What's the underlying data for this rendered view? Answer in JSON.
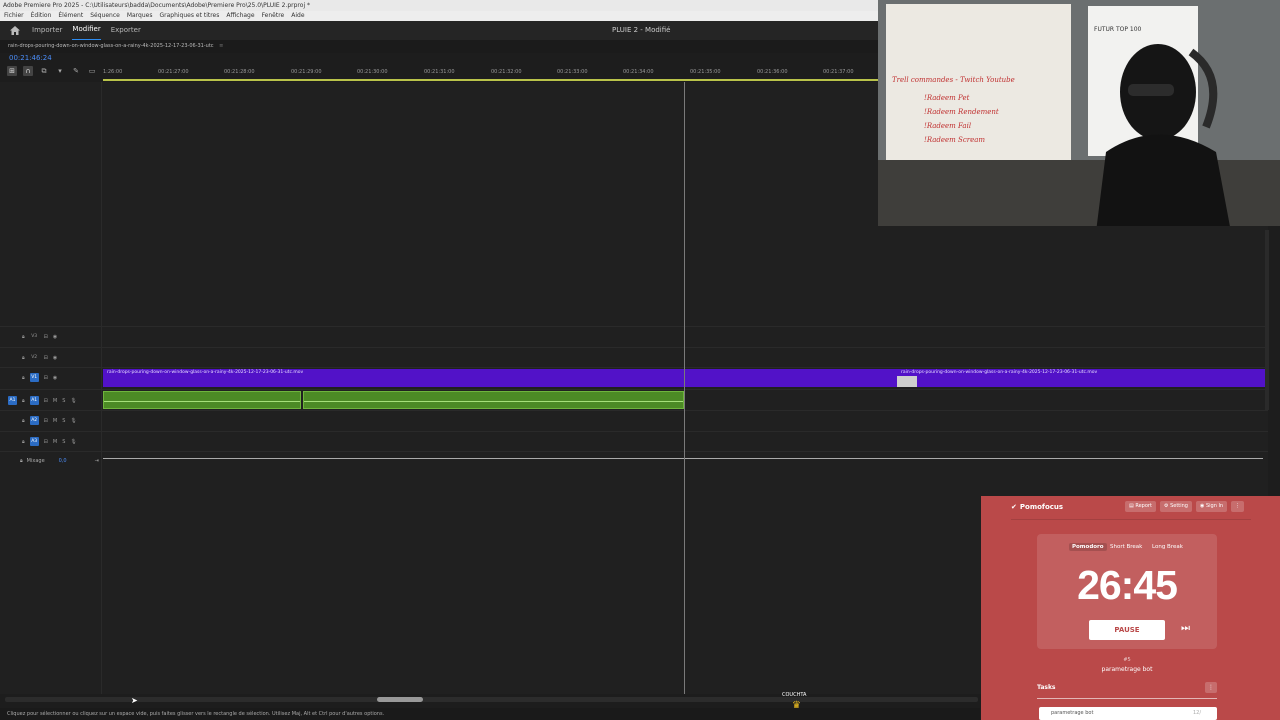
{
  "window": {
    "title": "Adobe Premiere Pro 2025 - C:\\Utilisateurs\\badda\\Documents\\Adobe\\Premiere Pro\\25.0\\PLUIE 2.prproj *"
  },
  "menu": [
    "Fichier",
    "Édition",
    "Élément",
    "Séquence",
    "Marques",
    "Graphiques et titres",
    "Affichage",
    "Fenêtre",
    "Aide"
  ],
  "appbar": {
    "tabs": [
      "Importer",
      "Modifier",
      "Exporter"
    ],
    "active_tab": "Modifier",
    "project": "PLUIE 2 - Modifié"
  },
  "sequence": {
    "tab_label": "rain-drops-pouring-down-on-window-glass-on-a-rainy-4k-2025-12-17-23-06-31-utc",
    "menu_glyph": "≡",
    "timecode": "00:21:46:24"
  },
  "ruler": [
    "1:26:00",
    "00:21:27:00",
    "00:21:28:00",
    "00:21:29:00",
    "00:21:30:00",
    "00:21:31:00",
    "00:21:32:00",
    "00:21:33:00",
    "00:21:34:00",
    "00:21:35:00",
    "00:21:36:00",
    "00:21:37:00"
  ],
  "tracks": {
    "video": [
      {
        "id": "V3"
      },
      {
        "id": "V2"
      },
      {
        "id": "V1"
      }
    ],
    "audio": [
      {
        "id": "A1",
        "m": "M",
        "s": "S"
      },
      {
        "id": "A2",
        "m": "M",
        "s": "S"
      },
      {
        "id": "A3",
        "m": "M",
        "s": "S"
      }
    ],
    "source_v1": "V1",
    "source_a1": "A1",
    "mix_label": "Mixage",
    "mix_value": "0,0"
  },
  "clips": {
    "video_label": "rain-drops-pouring-down-on-window-glass-on-a-rainy-4k-2025-12-17-23-06-31-utc.mov",
    "video2_label": "rain-drops-pouring-down-on-window-glass-on-a-rainy-4k-2025-12-17-23-06-31-utc.mov"
  },
  "status": "Cliquez pour sélectionner ou cliquez sur un espace vide, puis faites glisser vers le rectangle de sélection. Utilisez Maj, Alt et Ctrl pour d'autres options.",
  "overlay": {
    "couchta": "COUCHTA"
  },
  "webcam": {
    "board_lines": [
      "Trell commandes - Twitch Youtube",
      "!Radeem Pet",
      "!Radeem Rendement",
      "!Radeem Fail",
      "!Radeem Scream"
    ],
    "sign": "FUTUR TOP 100"
  },
  "pomofocus": {
    "brand": "Pomofocus",
    "buttons": [
      "Report",
      "Setting",
      "Sign In"
    ],
    "modes": [
      "Pomodoro",
      "Short Break",
      "Long Break"
    ],
    "active_mode": "Pomodoro",
    "time": "26:45",
    "pause_label": "PAUSE",
    "session": "#5",
    "task_name": "parametrage bot",
    "tasks_title": "Tasks",
    "task_item": "parametrage bot",
    "task_count": "12/",
    "colors": {
      "bg": "#ba4949"
    }
  }
}
